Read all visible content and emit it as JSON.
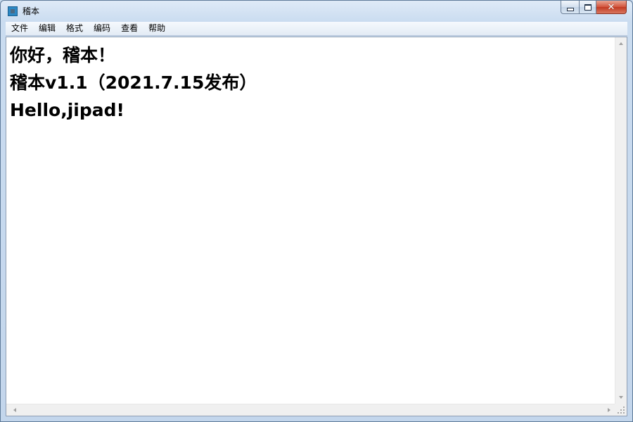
{
  "window": {
    "title": "稽本",
    "app_icon": "notepad-icon"
  },
  "caption_buttons": {
    "minimize_icon": "minimize-icon",
    "maximize_icon": "maximize-icon",
    "close_icon": "close-icon",
    "close_glyph": "✕"
  },
  "menu": {
    "items": [
      "文件",
      "编辑",
      "格式",
      "编码",
      "查看",
      "帮助"
    ]
  },
  "editor": {
    "lines": [
      "你好，稽本！",
      "稽本v1.1（2021.7.15发布）",
      "Hello,jipad!"
    ]
  },
  "colors": {
    "title_bar": "#cadcf0",
    "close_button": "#c94a33",
    "editor_background": "#ffffff",
    "text": "#000000"
  }
}
